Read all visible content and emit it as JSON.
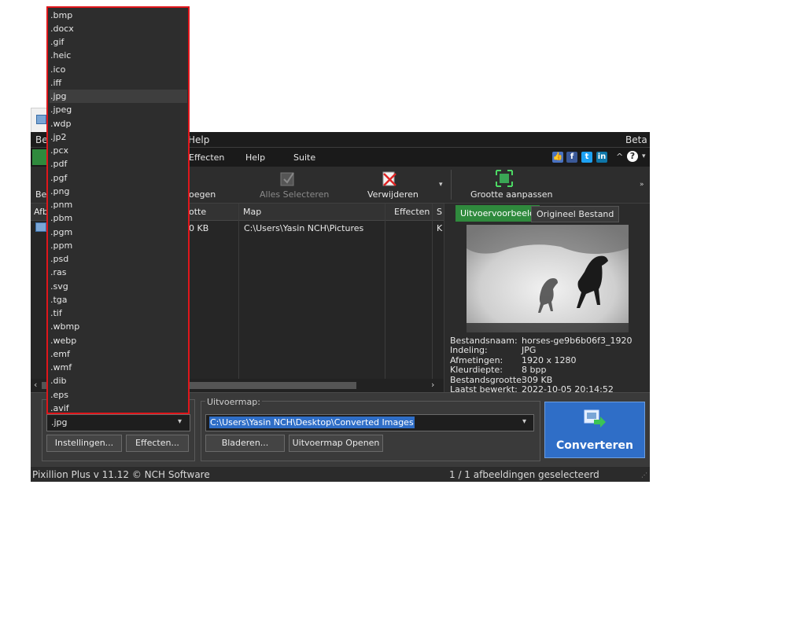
{
  "window": {
    "title_left": "Be",
    "menu_help_top": "Help",
    "beta": "Beta"
  },
  "menubar": {
    "items": [
      "Effecten",
      "Help",
      "Suite"
    ]
  },
  "toolbar": {
    "left_partial": "Be",
    "add_partial": "oegen",
    "select_all": "Alles Selecteren",
    "remove": "Verwijderen",
    "resize": "Grootte aanpassen"
  },
  "list": {
    "headers": {
      "image_partial": "Afb",
      "size_partial": "otte",
      "folder": "Map",
      "effects": "Effecten",
      "s_partial": "S"
    },
    "rows": [
      {
        "size_partial": "0 KB",
        "folder": "C:\\Users\\Yasin NCH\\Pictures",
        "s_partial": "K"
      }
    ]
  },
  "preview": {
    "tab_output": "Uitvoervoorbeeld",
    "tab_original": "Origineel Bestand",
    "info": [
      {
        "label": "Bestandsnaam:",
        "value": "horses-ge9b6b06f3_1920"
      },
      {
        "label": "Indeling:",
        "value": "JPG"
      },
      {
        "label": "Afmetingen:",
        "value": "1920 x 1280"
      },
      {
        "label": "Kleurdiepte:",
        "value": "8 bpp"
      },
      {
        "label": "Bestandsgrootte:",
        "value": "309 KB"
      },
      {
        "label": "Laatst bewerkt:",
        "value": "2022-10-05 20:14:52"
      }
    ]
  },
  "bottom": {
    "format_selected": ".jpg",
    "settings_button": "Instellingen...",
    "effects_button": "Effecten...",
    "output_folder_label": "Uitvoermap:",
    "output_folder_value": "C:\\Users\\Yasin NCH\\Desktop\\Converted Images",
    "browse_button": "Bladeren...",
    "open_folder_button": "Uitvoermap Openen",
    "convert_button": "Converteren"
  },
  "status": {
    "version": "Pixillion Plus v 11.12 © NCH Software",
    "selection": "1 / 1 afbeeldingen geselecteerd"
  },
  "dropdown": {
    "selected": ".jpg",
    "options": [
      ".bmp",
      ".docx",
      ".gif",
      ".heic",
      ".ico",
      ".iff",
      ".jpg",
      ".jpeg",
      ".wdp",
      ".jp2",
      ".pcx",
      ".pdf",
      ".pgf",
      ".png",
      ".pnm",
      ".pbm",
      ".pgm",
      ".ppm",
      ".psd",
      ".ras",
      ".svg",
      ".tga",
      ".tif",
      ".wbmp",
      ".webp",
      ".emf",
      ".wmf",
      ".dib",
      ".eps",
      ".avif"
    ]
  },
  "colors": {
    "highlight_border": "#e0161b",
    "convert_blue": "#2f6ec7",
    "preview_tab_green": "#2f8a3d"
  }
}
